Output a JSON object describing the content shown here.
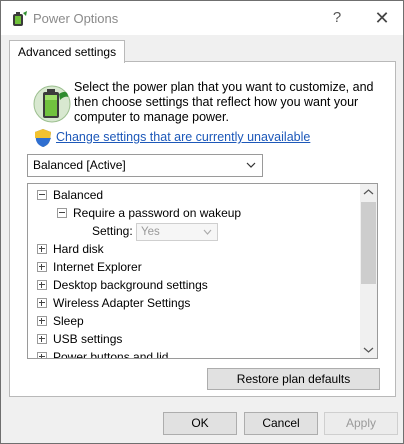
{
  "window": {
    "title": "Power Options",
    "help_label": "?",
    "close_label": "✕"
  },
  "tab": {
    "label": "Advanced settings"
  },
  "intro": {
    "text": "Select the power plan that you want to customize, and then choose settings that reflect how you want your computer to manage power."
  },
  "change_link": {
    "label": "Change settings that are currently unavailable"
  },
  "plan_select": {
    "value": "Balanced [Active]"
  },
  "tree": {
    "root_label": "Balanced",
    "subitem_label": "Require a password on wakeup",
    "setting_label": "Setting:",
    "setting_value": "Yes",
    "items": [
      "Hard disk",
      "Internet Explorer",
      "Desktop background settings",
      "Wireless Adapter Settings",
      "Sleep",
      "USB settings",
      "Power buttons and lid"
    ]
  },
  "buttons": {
    "restore": "Restore plan defaults",
    "ok": "OK",
    "cancel": "Cancel",
    "apply": "Apply"
  },
  "colors": {
    "link": "#1d58b9",
    "disabled_text": "#9a9a9a"
  }
}
